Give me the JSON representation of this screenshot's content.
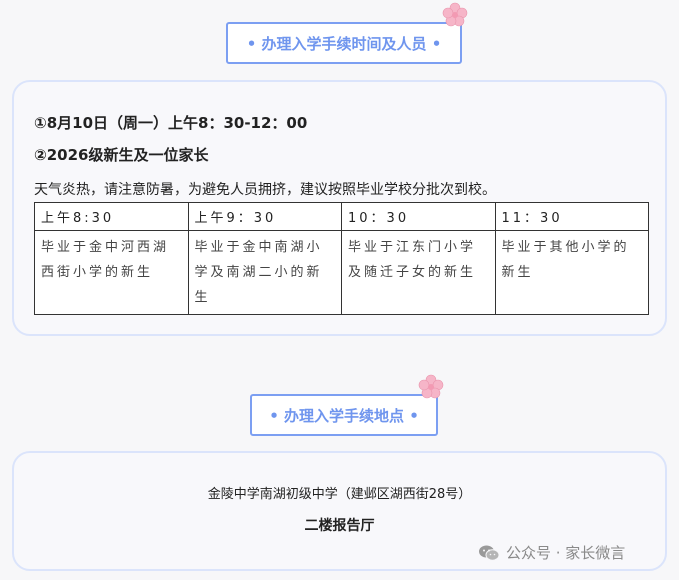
{
  "section1": {
    "title": "• 办理入学手续时间及人员 •",
    "line1": "①8月10日（周一）上午8：30-12：00",
    "line2": "②2026级新生及一位家长",
    "line3": "天气炎热，请注意防暑，为避免人员拥挤，建议按照毕业学校分批次到校。",
    "table": {
      "headers": [
        "上午8:30",
        "上午9：30",
        "10：30",
        "11：30"
      ],
      "cells": [
        "毕业于金中河西湖西街小学的新生",
        "毕业于金中南湖小学及南湖二小的新生",
        "毕业于江东门小学及随迁子女的新生",
        "毕业于其他小学的新生"
      ]
    }
  },
  "section2": {
    "title": "• 办理入学手续地点 •",
    "address": "金陵中学南湖初级中学（建邺区湖西街28号）",
    "room": "二楼报告厅"
  },
  "watermark": {
    "text": "公众号 · 家长微言",
    "icon": "wechat-icon"
  },
  "colors": {
    "accent": "#7c9ff2",
    "card_border": "#dbe4fb",
    "flower": "#f6b5c8"
  }
}
